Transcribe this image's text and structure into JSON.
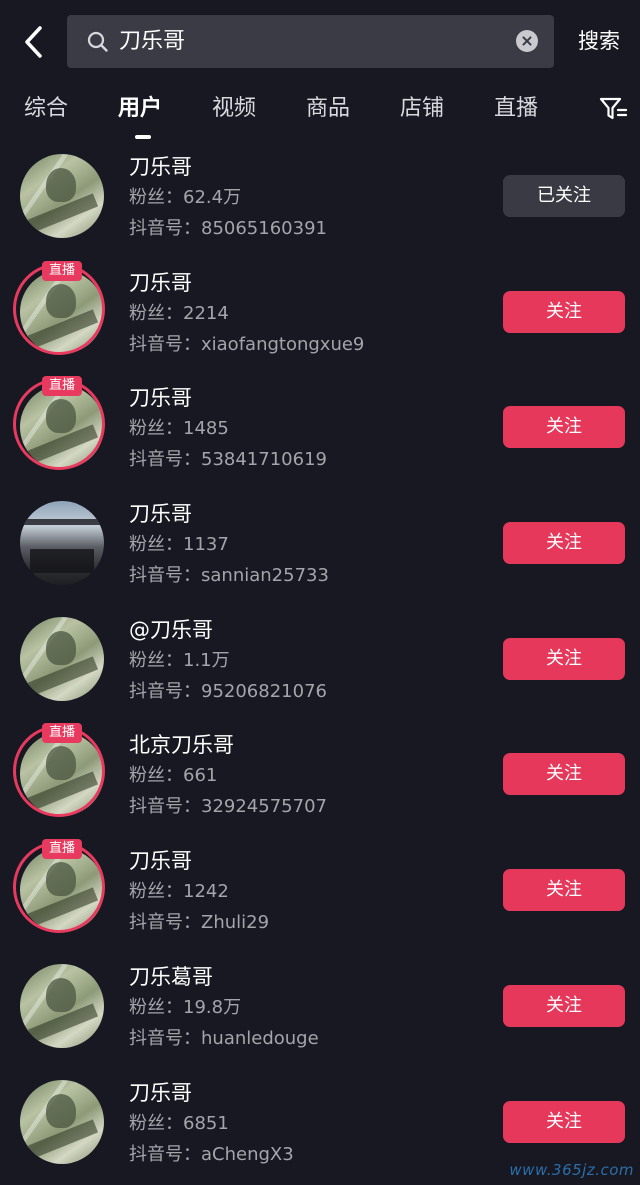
{
  "search": {
    "query": "刀乐哥",
    "button_label": "搜索"
  },
  "tabs": [
    {
      "label": "综合",
      "active": false
    },
    {
      "label": "用户",
      "active": true
    },
    {
      "label": "视频",
      "active": false
    },
    {
      "label": "商品",
      "active": false
    },
    {
      "label": "店铺",
      "active": false
    },
    {
      "label": "直播",
      "active": false
    }
  ],
  "live_badge": "直播",
  "fans_prefix": "粉丝：",
  "id_prefix": "抖音号：",
  "users": [
    {
      "name": "刀乐哥",
      "fans": "粉丝：62.4万",
      "douyin_id": "抖音号：85065160391",
      "button": "已关注",
      "followed": true,
      "live": false,
      "avatar": "dollar"
    },
    {
      "name": "刀乐哥",
      "fans": "粉丝：2214",
      "douyin_id": "抖音号：xiaofangtongxue9",
      "button": "关注",
      "followed": false,
      "live": true,
      "avatar": "dollar"
    },
    {
      "name": "刀乐哥",
      "fans": "粉丝：1485",
      "douyin_id": "抖音号：53841710619",
      "button": "关注",
      "followed": false,
      "live": true,
      "avatar": "dollar"
    },
    {
      "name": "刀乐哥",
      "fans": "粉丝：1137",
      "douyin_id": "抖音号：sannian25733",
      "button": "关注",
      "followed": false,
      "live": false,
      "avatar": "photo"
    },
    {
      "name": "@刀乐哥",
      "fans": "粉丝：1.1万",
      "douyin_id": "抖音号：95206821076",
      "button": "关注",
      "followed": false,
      "live": false,
      "avatar": "dollar"
    },
    {
      "name": "北京刀乐哥",
      "fans": "粉丝：661",
      "douyin_id": "抖音号：32924575707",
      "button": "关注",
      "followed": false,
      "live": true,
      "avatar": "dollar"
    },
    {
      "name": "刀乐哥",
      "fans": "粉丝：1242",
      "douyin_id": "抖音号：Zhuli29",
      "button": "关注",
      "followed": false,
      "live": true,
      "avatar": "dollar"
    },
    {
      "name": "刀乐葛哥",
      "fans": "粉丝：19.8万",
      "douyin_id": "抖音号：huanledouge",
      "button": "关注",
      "followed": false,
      "live": false,
      "avatar": "dollar"
    },
    {
      "name": "刀乐哥",
      "fans": "粉丝：6851",
      "douyin_id": "抖音号：aChengX3",
      "button": "关注",
      "followed": false,
      "live": false,
      "avatar": "dollar"
    }
  ],
  "watermark": "www.365jz.com",
  "colors": {
    "background": "#171822",
    "accent": "#e6385b",
    "followed_button": "#393a43"
  }
}
